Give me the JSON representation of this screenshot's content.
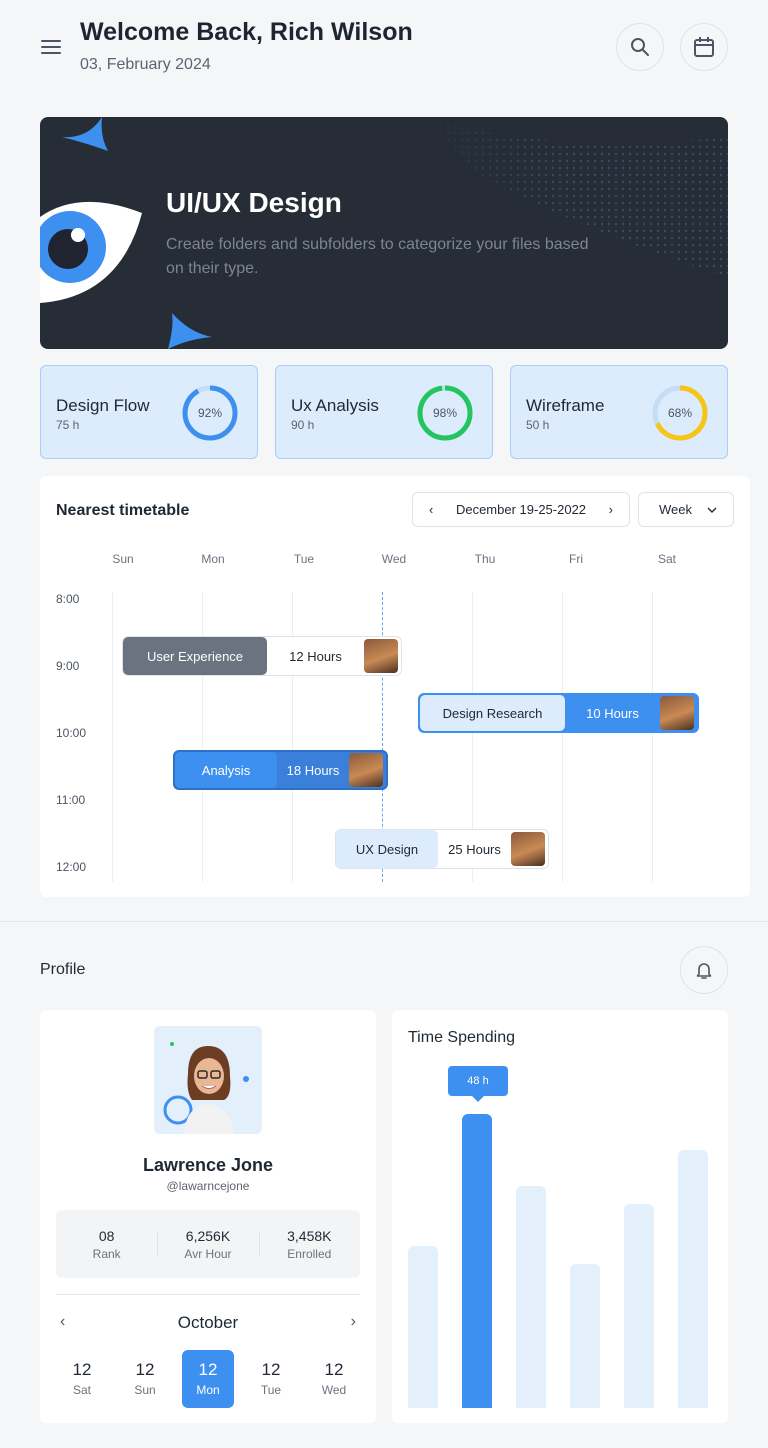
{
  "header": {
    "welcome": "Welcome Back, Rich Wilson",
    "date": "03, February 2024"
  },
  "hero": {
    "title": "UI/UX Design",
    "description": "Create folders and subfolders to categorize your files based on their type."
  },
  "stats": [
    {
      "title": "Design Flow",
      "hours": "75 h",
      "percent_label": "92%",
      "percent": 92,
      "color": "#3d8ff0"
    },
    {
      "title": "Ux Analysis",
      "hours": "90 h",
      "percent_label": "98%",
      "percent": 98,
      "color": "#22c55e"
    },
    {
      "title": "Wireframe",
      "hours": "50 h",
      "percent_label": "68%",
      "percent": 68,
      "color": "#f5c518"
    }
  ],
  "timetable": {
    "title": "Nearest timetable",
    "range": "December 19-25-2022",
    "period": "Week",
    "days": [
      "Sun",
      "Mon",
      "Tue",
      "Wed",
      "Thu",
      "Fri",
      "Sat"
    ],
    "times": [
      "8:00",
      "9:00",
      "10:00",
      "11:00",
      "12:00"
    ],
    "events": [
      {
        "name": "User Experience",
        "hours": "12 Hours"
      },
      {
        "name": "Design Research",
        "hours": "10 Hours"
      },
      {
        "name": "Analysis",
        "hours": "18 Hours"
      },
      {
        "name": "UX Design",
        "hours": "25 Hours"
      }
    ]
  },
  "profile": {
    "heading": "Profile",
    "name": "Lawrence Jone",
    "handle": "@lawarncejone",
    "stats": [
      {
        "value": "08",
        "label": "Rank"
      },
      {
        "value": "6,256K",
        "label": "Avr Hour"
      },
      {
        "value": "3,458K",
        "label": "Enrolled"
      }
    ],
    "month": "October",
    "days": [
      {
        "num": "12",
        "weekday": "Sat"
      },
      {
        "num": "12",
        "weekday": "Sun"
      },
      {
        "num": "12",
        "weekday": "Mon"
      },
      {
        "num": "12",
        "weekday": "Tue"
      },
      {
        "num": "12",
        "weekday": "Wed"
      }
    ]
  },
  "time_spending": {
    "title": "Time Spending",
    "tooltip": "48 h"
  },
  "chart_data": {
    "type": "bar",
    "title": "Time Spending",
    "values": [
      27,
      49,
      37,
      24,
      34,
      43
    ],
    "highlight_index": 1,
    "highlight_label": "48 h",
    "colors": {
      "bar": "#e3f0fc",
      "highlight": "#3d8ff0"
    }
  }
}
